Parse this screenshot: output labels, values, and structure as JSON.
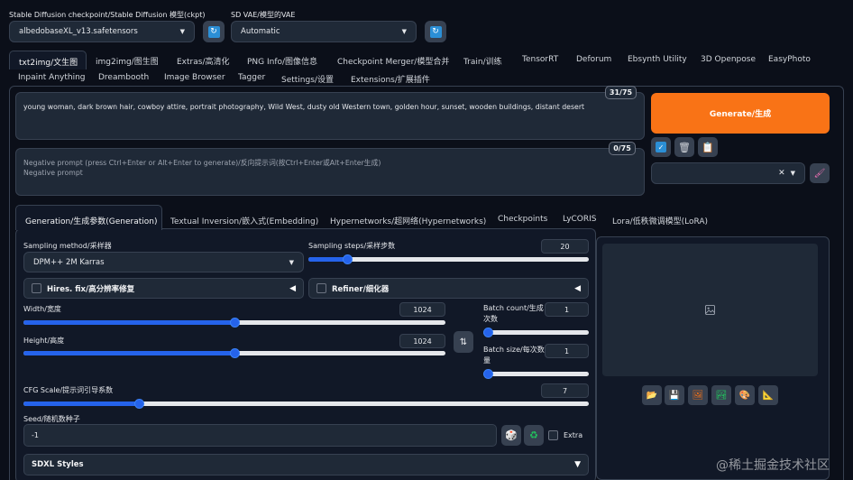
{
  "header": {
    "checkpoint_label": "Stable Diffusion checkpoint/Stable Diffusion 模型(ckpt)",
    "checkpoint_value": "albedobaseXL_v13.safetensors",
    "vae_label": "SD VAE/模型的VAE",
    "vae_value": "Automatic"
  },
  "main_tabs_row1": [
    "txt2img/文生图",
    "img2img/图生图",
    "Extras/高清化",
    "PNG Info/图像信息",
    "Checkpoint Merger/模型合并",
    "Train/训练",
    "TensorRT",
    "Deforum",
    "Ebsynth Utility",
    "3D Openpose",
    "EasyPhoto"
  ],
  "main_tabs_row2": [
    "Inpaint Anything",
    "Dreambooth",
    "Image Browser",
    "Tagger",
    "Settings/设置",
    "Extensions/扩展插件"
  ],
  "prompt": {
    "text": "young woman, dark brown hair, cowboy attire, portrait photography, Wild West, dusty old Western town, golden hour, sunset, wooden buildings, distant desert",
    "counter": "31/75"
  },
  "negative_prompt": {
    "placeholder_line1": "Negative prompt (press Ctrl+Enter or Alt+Enter to generate)/反向提示词(按Ctrl+Enter或Alt+Enter生成)",
    "placeholder_line2": "Negative prompt",
    "counter": "0/75"
  },
  "generate_label": "Generate/生成",
  "sub_tabs": [
    "Generation/生成参数(Generation)",
    "Textual Inversion/嵌入式(Embedding)",
    "Hypernetworks/超网络(Hypernetworks)",
    "Checkpoints",
    "LyCORIS",
    "Lora/低秩微调模型(LoRA)"
  ],
  "sampling": {
    "method_label": "Sampling method/采样器",
    "method_value": "DPM++ 2M Karras",
    "steps_label": "Sampling steps/采样步数",
    "steps_value": "20",
    "steps_fraction": 0.127
  },
  "hires_label": "Hires. fix/高分辨率修复",
  "refiner_label": "Refiner/细化器",
  "width": {
    "label": "Width/宽度",
    "value": "1024",
    "fraction": 0.5
  },
  "height": {
    "label": "Height/高度",
    "value": "1024",
    "fraction": 0.5
  },
  "batch_count": {
    "label_line1": "Batch count/生成",
    "label_line2": "次数",
    "value": "1",
    "fraction": 0
  },
  "batch_size": {
    "label_line1": "Batch size/每次数",
    "label_line2": "量",
    "value": "1",
    "fraction": 0
  },
  "cfg": {
    "label": "CFG Scale/提示词引导系数",
    "value": "7",
    "fraction": 0.2
  },
  "seed": {
    "label": "Seed/随机数种子",
    "value": "-1",
    "extra_label": "Extra"
  },
  "sdxl_styles_label": "SDXL Styles",
  "watermark": "@稀土掘金技术社区",
  "colors": {
    "background": "#0b0f19",
    "accent": "#f97316",
    "slider": "#2563eb"
  }
}
